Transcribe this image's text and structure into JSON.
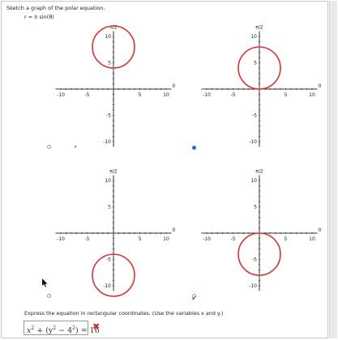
{
  "prompt": {
    "instruction": "Sketch a graph of the polar equation.",
    "equation_lhs": "r = ",
    "equation_coef": "8",
    "equation_rhs": " sin(θ)"
  },
  "graphs": [
    {
      "id": "a",
      "selected": false,
      "axis_top_label": "π/2",
      "axis_right_label": "0",
      "x_ticks": [
        "-10",
        "-5",
        "5",
        "10"
      ],
      "y_ticks": [
        "10",
        "5",
        "-5",
        "-10"
      ],
      "circle_center": [
        0,
        8
      ],
      "circle_radius": 4
    },
    {
      "id": "b",
      "selected": true,
      "axis_top_label": "π/2",
      "axis_right_label": "0",
      "x_ticks": [
        "-10",
        "-5",
        "5",
        "10"
      ],
      "y_ticks": [
        "10",
        "5",
        "-5",
        "-10"
      ],
      "circle_center": [
        0,
        4
      ],
      "circle_radius": 4
    },
    {
      "id": "c",
      "selected": false,
      "axis_top_label": "π/2",
      "axis_right_label": "0",
      "x_ticks": [
        "-10",
        "-5",
        "5",
        "10"
      ],
      "y_ticks": [
        "10",
        "5",
        "-5",
        "-10"
      ],
      "circle_center": [
        0,
        -8
      ],
      "circle_radius": 4
    },
    {
      "id": "d",
      "selected": false,
      "axis_top_label": "π/2",
      "axis_right_label": "0",
      "x_ticks": [
        "-10",
        "-5",
        "5",
        "10"
      ],
      "y_ticks": [
        "10",
        "5",
        "-5",
        "-10"
      ],
      "circle_center": [
        0,
        -4
      ],
      "circle_radius": 4
    }
  ],
  "part2": {
    "instruction": "Express the equation in rectangular coordinates. (Use the variables x and y.)",
    "answer_x": "x",
    "answer_x_exp": "2",
    "answer_plus": " + ",
    "answer_paren_open": "(y",
    "answer_y_exp": "2",
    "answer_minus": " − 4",
    "answer_four_exp": "2",
    "answer_paren_close": ")",
    "answer_equals": " = 16",
    "status": "incorrect"
  },
  "colors": {
    "circle": "#e03030",
    "axis": "#333333",
    "selected_radio": "#1f6fd6",
    "check": "#3a9a2a",
    "cross": "#dd2222"
  },
  "icons": {
    "correct": "check-icon",
    "incorrect": "x-icon",
    "pointer": "mouse-cursor-icon"
  }
}
